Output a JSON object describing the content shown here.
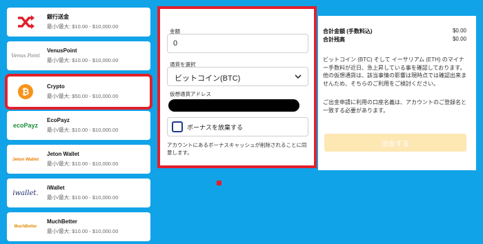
{
  "methods": [
    {
      "name": "銀行送金",
      "limit": "最小/最大: $10.00 - $10,000.00",
      "icon": "bank-transfer-icon"
    },
    {
      "name": "VenusPoint",
      "limit": "最小/最大: $10.00 - $10,000.00",
      "icon": "venuspoint-logo",
      "logo_text": "Venus Point"
    },
    {
      "name": "Crypto",
      "limit": "最小/最大: $50.00 - $10,000.00",
      "icon": "bitcoin-icon"
    },
    {
      "name": "EcoPayz",
      "limit": "最小/最大: $10.00 - $10,000.00",
      "icon": "ecopayz-logo",
      "logo_text": "ecoPayz"
    },
    {
      "name": "Jeton Wallet",
      "limit": "最小/最大: $10.00 - $10,000.00",
      "icon": "jeton-logo",
      "logo_text": "Jeton Wallet"
    },
    {
      "name": "iWallet",
      "limit": "最小/最大: $10.00 - $10,000.00",
      "icon": "iwallet-logo",
      "logo_text": "iwallet."
    },
    {
      "name": "MuchBetter",
      "limit": "最小/最大: $10.00 - $10,000.00",
      "icon": "muchbetter-logo",
      "logo_text": "MuchBetter"
    }
  ],
  "form": {
    "amount_label": "金額",
    "amount_value": "0",
    "currency_label": "通貨を選択",
    "currency_value": "ビットコイン(BTC)",
    "address_label": "仮想通貨アドレス",
    "bonus_label": "ボーナスを放棄する",
    "note": "アカウントにあるボーナスキャッシュが削除されることに同意します。"
  },
  "summary": {
    "total_label": "合計金額 (手数料込)",
    "total_value": "$0.00",
    "balance_label": "合計残高",
    "balance_value": "$0.00",
    "info1": "ビットコイン (BTC) そして イーサリアム (ETH) のマイナー手数料が近日、急上昇している事を確認しております。 他の仮想通貨は、該当事情の影響は現時点では確認出来ませんため、そちらのご利用をご検討ください。",
    "info2": "ご出金申請に利用の口座名義は、アカウントのご登録名と一致する必要があります。",
    "withdraw_button": "出金する"
  },
  "colors": {
    "background": "#11a3e8",
    "highlight": "#e1202b",
    "button_disabled": "#fde7b3"
  }
}
